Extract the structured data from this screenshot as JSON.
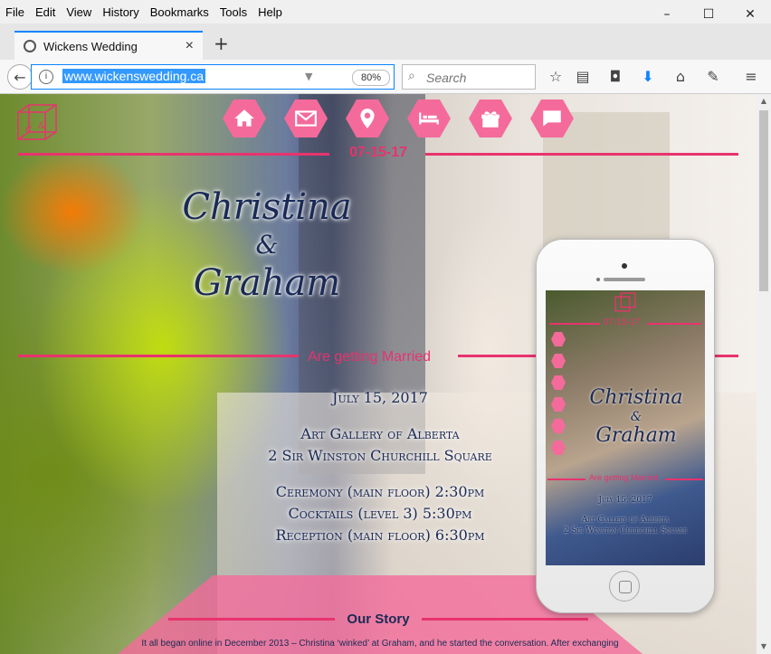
{
  "menu": [
    "File",
    "Edit",
    "View",
    "History",
    "Bookmarks",
    "Tools",
    "Help"
  ],
  "window": {
    "minimize": "–",
    "maximize": "☐",
    "close": "✕"
  },
  "tab": {
    "title": "Wickens Wedding",
    "close": "×",
    "new": "+"
  },
  "nav": {
    "url": "www.wickenswedding.ca",
    "zoom": "80%",
    "search_placeholder": "Search"
  },
  "site": {
    "date_short": "07-15-17",
    "name1": "Christina",
    "amp": "&",
    "name2": "Graham",
    "tagline": "Are getting Married",
    "date_long": "July 15, 2017",
    "venue": "Art Gallery of Alberta",
    "address": "2 Sir Winston Churchill Square",
    "ceremony": "Ceremony (main floor) 2:30pm",
    "cocktails": "Cocktails (level 3) 5:30pm",
    "reception": "Reception (main floor) 6:30pm",
    "story_title": "Our Story",
    "story_text": "It all began online in December 2013 – Christina ‘winked’ at Graham, and he started the conversation. After exchanging"
  },
  "phone": {
    "date_short": "07-15-17",
    "name1": "Christina",
    "amp": "&",
    "name2": "Graham",
    "tagline": "Are getting Married",
    "date_long": "July 15, 2017",
    "venue": "Art Gallery of Alberta",
    "address": "2 Sir Winston Churchill Square"
  },
  "icons": [
    "home-icon",
    "envelope-icon",
    "location-pin-icon",
    "bed-icon",
    "gift-icon",
    "chat-icon"
  ],
  "colors": {
    "accent": "#e8336e",
    "hex": "#f46b9b",
    "navy": "#1a2a55"
  }
}
